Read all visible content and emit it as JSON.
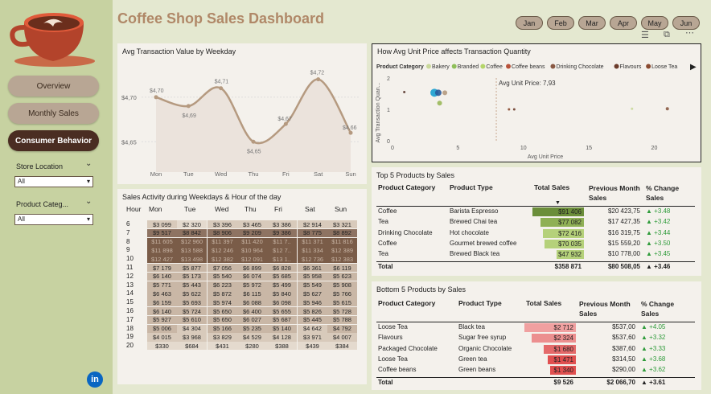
{
  "app": {
    "title": "Coffee Shop Sales Dashboard"
  },
  "nav": {
    "overview": "Overview",
    "monthly_sales": "Monthly Sales",
    "consumer_behavior": "Consumer Behavior"
  },
  "filters": {
    "store_location_label": "Store Location",
    "store_location_value": "All",
    "product_category_label": "Product Categ...",
    "product_category_value": "All"
  },
  "months": [
    "Jan",
    "Feb",
    "Mar",
    "Apr",
    "May",
    "Jun"
  ],
  "avg_weekday": {
    "title": "Avg Transaction Value by Weekday",
    "chart_data": {
      "type": "area",
      "categories": [
        "Mon",
        "Tue",
        "Wed",
        "Thu",
        "Fri",
        "Sat",
        "Sun"
      ],
      "values": [
        4.7,
        4.69,
        4.71,
        4.65,
        4.67,
        4.72,
        4.66
      ],
      "data_labels": [
        "$4,70",
        "$4,69",
        "$4,71",
        "$4,65",
        "$4,67",
        "$4,72",
        "$4,66"
      ],
      "y_ticks": [
        "$4,70",
        "$4,65"
      ],
      "ylim": [
        4.625,
        4.735
      ],
      "color": "#b59a80"
    }
  },
  "scatter": {
    "title": "How Avg Unit Price affects Transaction Quantity",
    "legend_title": "Product Category",
    "legend": [
      {
        "name": "Bakery",
        "color": "#c9d89a"
      },
      {
        "name": "Branded",
        "color": "#8fbf5a"
      },
      {
        "name": "Coffee",
        "color": "#b5d56a"
      },
      {
        "name": "Coffee beans",
        "color": "#b8523a"
      },
      {
        "name": "Drinking Chocolate",
        "color": "#8a5a44"
      },
      {
        "name": "Flavours",
        "color": "#6b3b2a"
      },
      {
        "name": "Loose Tea",
        "color": "#8a4a30"
      }
    ],
    "annotation": "Avg Unit Price: 7,93",
    "xlabel": "Avg Unit Price",
    "ylabel": "Avg Transaction Quan...",
    "chart_data": {
      "type": "scatter",
      "xlim": [
        0,
        22
      ],
      "ylim": [
        0,
        2
      ],
      "x_ticks": [
        0,
        5,
        10,
        15,
        20
      ],
      "y_ticks": [
        0,
        1,
        2
      ],
      "points": [
        {
          "x": 0.9,
          "y": 1.55,
          "color": "#5a3a30",
          "r": 1.5
        },
        {
          "x": 3.2,
          "y": 1.53,
          "color": "#1a9fd0",
          "r": 5
        },
        {
          "x": 3.5,
          "y": 1.53,
          "color": "#2a5a9a",
          "r": 4
        },
        {
          "x": 4.0,
          "y": 1.53,
          "color": "#b59a80",
          "r": 3
        },
        {
          "x": 3.6,
          "y": 1.2,
          "color": "#9ab85a",
          "r": 3
        },
        {
          "x": 8.9,
          "y": 1.0,
          "color": "#8a4a30",
          "r": 1.5
        },
        {
          "x": 9.3,
          "y": 1.0,
          "color": "#6b3b2a",
          "r": 1.5
        },
        {
          "x": 18.3,
          "y": 1.02,
          "color": "#c9d89a",
          "r": 1.5
        },
        {
          "x": 21.0,
          "y": 1.02,
          "color": "#8a5a44",
          "r": 2
        }
      ],
      "ref_x": 7.93
    }
  },
  "heatmap": {
    "title": "Sales Activity during Weekdays & Hour of the day",
    "hour_label": "Hour",
    "days": [
      "Mon",
      "Tue",
      "Wed",
      "Thu",
      "Fri",
      "Sat",
      "Sun"
    ],
    "rows": [
      {
        "hour": "6",
        "cells": [
          "$3 099",
          "$2 320",
          "$3 396",
          "$3 465",
          "$3 386",
          "$2 914",
          "$3 321"
        ],
        "vals": [
          3099,
          2320,
          3396,
          3465,
          3386,
          2914,
          3321
        ]
      },
      {
        "hour": "7",
        "cells": [
          "$9 517",
          "$8 842",
          "$8 906",
          "$9 209",
          "$9 386",
          "$8 775",
          "$8 892"
        ],
        "vals": [
          9517,
          8842,
          8906,
          9209,
          9386,
          8775,
          8892
        ]
      },
      {
        "hour": "8",
        "cells": [
          "$11 605",
          "$12 960",
          "$11 397",
          "$11 420",
          "$11 7..",
          "$11 371",
          "$11 816"
        ],
        "vals": [
          11605,
          12960,
          11397,
          11420,
          11700,
          11371,
          11816
        ]
      },
      {
        "hour": "9",
        "cells": [
          "$11 898",
          "$13 588",
          "$12 246",
          "$10 964",
          "$12 7..",
          "$11 334",
          "$12 389"
        ],
        "vals": [
          11898,
          13588,
          12246,
          10964,
          12700,
          11334,
          12389
        ]
      },
      {
        "hour": "10",
        "cells": [
          "$12 427",
          "$13 498",
          "$12 382",
          "$12 091",
          "$13 1..",
          "$12 736",
          "$12 383"
        ],
        "vals": [
          12427,
          13498,
          12382,
          12091,
          13100,
          12736,
          12383
        ]
      },
      {
        "hour": "11",
        "cells": [
          "$7 179",
          "$5 877",
          "$7 056",
          "$6 899",
          "$6 828",
          "$6 361",
          "$6 119"
        ],
        "vals": [
          7179,
          5877,
          7056,
          6899,
          6828,
          6361,
          6119
        ]
      },
      {
        "hour": "12",
        "cells": [
          "$6 140",
          "$5 173",
          "$5 540",
          "$6 074",
          "$5 685",
          "$5 958",
          "$5 623"
        ],
        "vals": [
          6140,
          5173,
          5540,
          6074,
          5685,
          5958,
          5623
        ]
      },
      {
        "hour": "13",
        "cells": [
          "$5 771",
          "$5 443",
          "$6 223",
          "$5 972",
          "$5 499",
          "$5 549",
          "$5 908"
        ],
        "vals": [
          5771,
          5443,
          6223,
          5972,
          5499,
          5549,
          5908
        ]
      },
      {
        "hour": "14",
        "cells": [
          "$6 463",
          "$5 622",
          "$5 872",
          "$6 115",
          "$5 840",
          "$5 627",
          "$5 766"
        ],
        "vals": [
          6463,
          5622,
          5872,
          6115,
          5840,
          5627,
          5766
        ]
      },
      {
        "hour": "15",
        "cells": [
          "$6 159",
          "$5 693",
          "$5 974",
          "$6 088",
          "$6 098",
          "$5 946",
          "$5 615"
        ],
        "vals": [
          6159,
          5693,
          5974,
          6088,
          6098,
          5946,
          5615
        ]
      },
      {
        "hour": "16",
        "cells": [
          "$6 140",
          "$5 724",
          "$5 650",
          "$6 400",
          "$5 655",
          "$5 826",
          "$5 728"
        ],
        "vals": [
          6140,
          5724,
          5650,
          6400,
          5655,
          5826,
          5728
        ]
      },
      {
        "hour": "17",
        "cells": [
          "$5 927",
          "$5 610",
          "$5 650",
          "$6 027",
          "$5 687",
          "$5 445",
          "$5 788"
        ],
        "vals": [
          5927,
          5610,
          5650,
          6027,
          5687,
          5445,
          5788
        ]
      },
      {
        "hour": "18",
        "cells": [
          "$5 006",
          "$4 304",
          "$5 166",
          "$5 235",
          "$5 140",
          "$4 642",
          "$4 792"
        ],
        "vals": [
          5006,
          4304,
          5166,
          5235,
          5140,
          4642,
          4792
        ]
      },
      {
        "hour": "19",
        "cells": [
          "$4 015",
          "$3 968",
          "$3 829",
          "$4 529",
          "$4 128",
          "$3 971",
          "$4 007"
        ],
        "vals": [
          4015,
          3968,
          3829,
          4529,
          4128,
          3971,
          4007
        ]
      },
      {
        "hour": "20",
        "cells": [
          "$330",
          "$684",
          "$431",
          "$280",
          "$388",
          "$439",
          "$384"
        ],
        "vals": [
          330,
          684,
          431,
          280,
          388,
          439,
          384
        ]
      }
    ]
  },
  "top5": {
    "title": "Top 5 Products by Sales",
    "headers": {
      "category": "Product Category",
      "type": "Product Type",
      "total": "Total Sales",
      "prev": "Previous Month Sales",
      "change": "% Change Sales"
    },
    "rows": [
      {
        "category": "Coffee",
        "type": "Barista Espresso",
        "total": "$91 406",
        "value": 91406,
        "prev": "$20 423,75",
        "change": "+3.48"
      },
      {
        "category": "Tea",
        "type": "Brewed Chai tea",
        "total": "$77 082",
        "value": 77082,
        "prev": "$17 427,35",
        "change": "+3.42"
      },
      {
        "category": "Drinking Chocolate",
        "type": "Hot chocolate",
        "total": "$72 416",
        "value": 72416,
        "prev": "$16 319,75",
        "change": "+3.44"
      },
      {
        "category": "Coffee",
        "type": "Gourmet brewed coffee",
        "total": "$70 035",
        "value": 70035,
        "prev": "$15 559,20",
        "change": "+3.50"
      },
      {
        "category": "Tea",
        "type": "Brewed Black tea",
        "total": "$47 932",
        "value": 47932,
        "prev": "$10 778,00",
        "change": "+3.45"
      }
    ],
    "total_label": "Total",
    "total": "$358 871",
    "total_prev": "$80 508,05",
    "total_change": "+3.46"
  },
  "bottom5": {
    "title": "Bottom 5 Products by Sales",
    "headers": {
      "category": "Product Category",
      "type": "Product Type",
      "total": "Total Sales",
      "prev": "Previous Month Sales",
      "change": "% Change Sales"
    },
    "rows": [
      {
        "category": "Loose Tea",
        "type": "Black tea",
        "total": "$2 712",
        "value": 2712,
        "prev": "$537,00",
        "change": "+4.05"
      },
      {
        "category": "Flavours",
        "type": "Sugar free syrup",
        "total": "$2 324",
        "value": 2324,
        "prev": "$537,60",
        "change": "+3.32"
      },
      {
        "category": "Packaged Chocolate",
        "type": "Organic Chocolate",
        "total": "$1 680",
        "value": 1680,
        "prev": "$387,60",
        "change": "+3.33"
      },
      {
        "category": "Loose Tea",
        "type": "Green tea",
        "total": "$1 471",
        "value": 1471,
        "prev": "$314,50",
        "change": "+3.68"
      },
      {
        "category": "Coffee beans",
        "type": "Green beans",
        "total": "$1 340",
        "value": 1340,
        "prev": "$290,00",
        "change": "+3.62"
      }
    ],
    "total_label": "Total",
    "total": "$9 526",
    "total_prev": "$2 066,70",
    "total_change": "+3.61"
  }
}
